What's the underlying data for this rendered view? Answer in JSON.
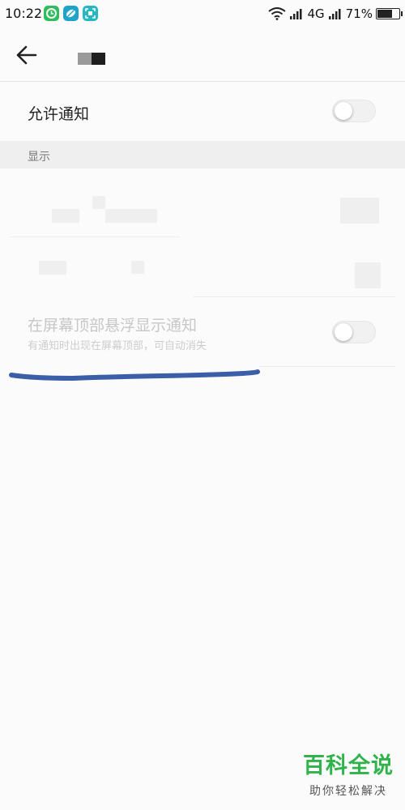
{
  "status_bar": {
    "time": "10:22",
    "network": "4G",
    "battery_text": "71%",
    "battery_level": 0.71,
    "app_icons": [
      {
        "name": "green-refresh-app-icon",
        "color": "#2dbd5a"
      },
      {
        "name": "teal-leaf-app-icon",
        "color": "#1fa3c9"
      },
      {
        "name": "teal-scan-app-icon",
        "color": "#26b7c3"
      }
    ]
  },
  "header": {
    "back_icon": "arrow-left-icon"
  },
  "settings": {
    "allow_notifications": {
      "label": "允许通知",
      "enabled": false
    },
    "section_display": "显示",
    "floating": {
      "label": "在屏幕顶部悬浮显示通知",
      "description": "有通知时出现在屏幕顶部，可自动消失",
      "enabled": false
    }
  },
  "annotation": {
    "color": "#3a5ea8"
  },
  "watermark": {
    "title": "百科全说",
    "subtitle": "助你轻松解决",
    "color": "#2fb34a"
  }
}
